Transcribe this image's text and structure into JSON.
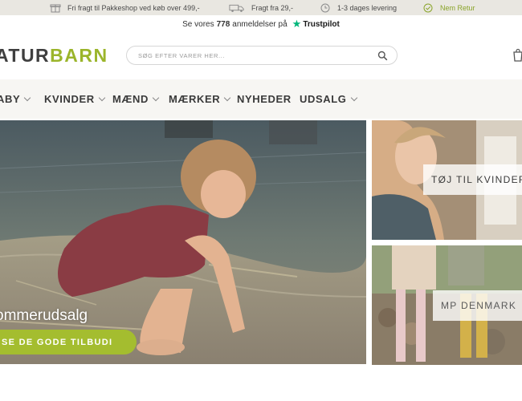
{
  "usp_bar": {
    "items": [
      {
        "icon": "gift-icon",
        "text": "Fri fragt til Pakkeshop ved køb over 499,-"
      },
      {
        "icon": "truck-icon",
        "text": "Fragt fra 29,-"
      },
      {
        "icon": "clock-icon",
        "text": "1-3 dages levering"
      },
      {
        "icon": "return-icon",
        "text": "Nem Retur"
      }
    ],
    "accent": "#8aa42a",
    "background": "#e9e7e1"
  },
  "trust": {
    "prefix": "Se vores",
    "count": "778",
    "suffix": "anmeldelser på",
    "brand": "Trustpilot",
    "star_color": "#00b67a"
  },
  "header": {
    "logo_part1": "ATUR",
    "logo_part2": "BARN",
    "logo_color_dark": "#3f3f3f",
    "logo_color_green": "#9bb52b",
    "search_placeholder": "SØG EFTER VARER HER...",
    "search_value": "",
    "cart_icon": "shopping-bag-icon"
  },
  "nav": {
    "items": [
      {
        "label": "ABY",
        "has_dropdown": true
      },
      {
        "label": "KVINDER",
        "has_dropdown": true
      },
      {
        "label": "MÆND",
        "has_dropdown": true
      },
      {
        "label": "MÆRKER",
        "has_dropdown": true
      },
      {
        "label": "NYHEDER",
        "has_dropdown": false
      },
      {
        "label": "UDSALG",
        "has_dropdown": true
      }
    ]
  },
  "hero": {
    "title": "ommerudsalg",
    "cta": "SE DE GODE TILBUDI",
    "cta_color": "#a4bd2f"
  },
  "side_banners": [
    {
      "label": "TØJ TIL KVINDER"
    },
    {
      "label": "MP DENMARK"
    }
  ]
}
